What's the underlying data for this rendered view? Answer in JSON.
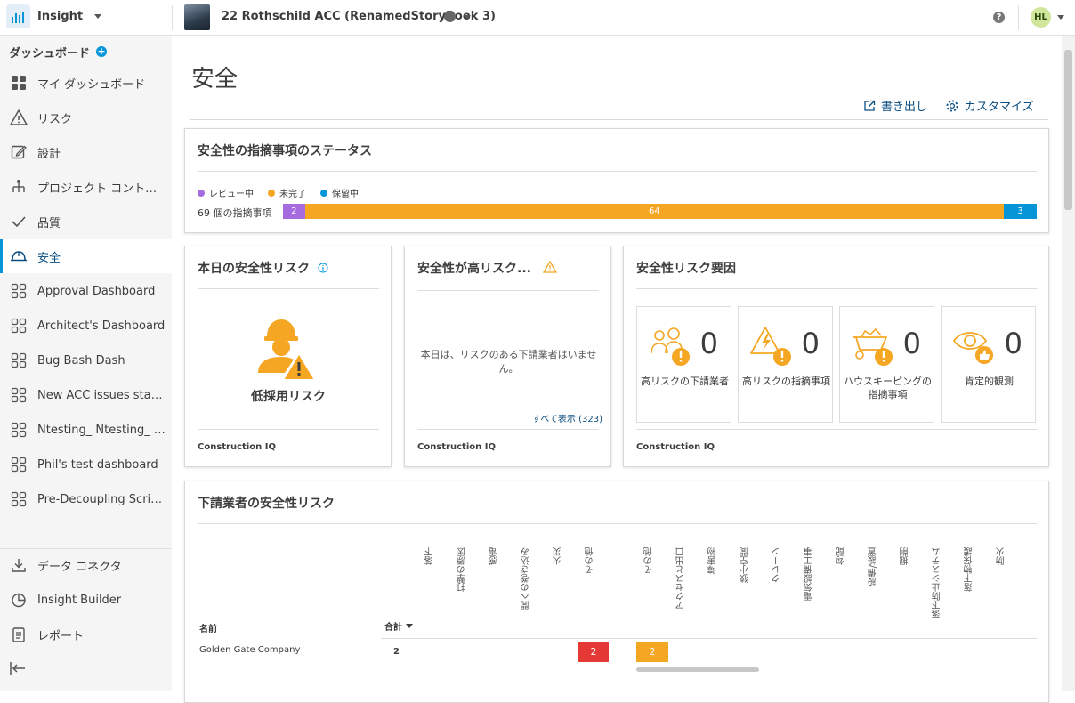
{
  "header": {
    "app_name": "Insight",
    "project_name": "22 Rothschild ACC (RenamedStoryBook 3)",
    "help": "?",
    "avatar_initials": "HL"
  },
  "sidebar": {
    "heading": "ダッシュボード",
    "items": [
      {
        "label": "マイ ダッシュボード",
        "icon": "grid-icon"
      },
      {
        "label": "リスク",
        "icon": "warning-icon"
      },
      {
        "label": "設計",
        "icon": "pencil-icon"
      },
      {
        "label": "プロジェクト コントロ...",
        "icon": "hierarchy-icon"
      },
      {
        "label": "品質",
        "icon": "check-icon"
      },
      {
        "label": "安全",
        "icon": "hard-hat-icon"
      },
      {
        "label": "Approval Dashboard",
        "icon": "dashboard-icon"
      },
      {
        "label": "Architect's Dashboard",
        "icon": "dashboard-icon"
      },
      {
        "label": "Bug Bash Dash",
        "icon": "dashboard-icon"
      },
      {
        "label": "New ACC issues status...",
        "icon": "dashboard-icon"
      },
      {
        "label": "Ntesting_ Ntesting_ N...",
        "icon": "dashboard-icon"
      },
      {
        "label": "Phil's test dashboard",
        "icon": "dashboard-icon"
      },
      {
        "label": "Pre-Decoupling Script ...",
        "icon": "dashboard-icon"
      }
    ],
    "bottom_items": [
      {
        "label": "データ コネクタ",
        "icon": "download-icon"
      },
      {
        "label": "Insight Builder",
        "icon": "pie-chart-icon"
      },
      {
        "label": "レポート",
        "icon": "report-icon"
      }
    ],
    "active_index": 5
  },
  "page": {
    "title": "安全",
    "export_label": "書き出し",
    "customize_label": "カスタマイズ"
  },
  "status_card": {
    "title": "安全性の指摘事項のステータス",
    "legend": [
      {
        "label": "レビュー中",
        "color": "#a56bdf"
      },
      {
        "label": "未完了",
        "color": "#f5a623"
      },
      {
        "label": "保留中",
        "color": "#0696d7"
      }
    ],
    "count_label": "69 個の指摘事項",
    "segments": [
      {
        "value": 2,
        "color": "#a56bdf"
      },
      {
        "value": 64,
        "color": "#f5a623"
      },
      {
        "value": 3,
        "color": "#0696d7"
      }
    ]
  },
  "today_card": {
    "title": "本日の安全性リスク",
    "risk_label": "低採用リスク",
    "footer": "Construction IQ"
  },
  "high_risk_card": {
    "title": "安全性が高リスク...",
    "empty_text": "本日は、リスクのある下請業者はいません。",
    "view_all": "すべて表示 (323)",
    "footer": "Construction IQ"
  },
  "factors_card": {
    "title": "安全性リスク要因",
    "factors": [
      {
        "label": "高リスクの下請業者",
        "value": "0"
      },
      {
        "label": "高リスクの指摘事項",
        "value": "0"
      },
      {
        "label": "ハウスキーピングの指摘事項",
        "value": "0"
      },
      {
        "label": "肯定的観測",
        "value": "0"
      }
    ],
    "footer": "Construction IQ"
  },
  "sub_card": {
    "title": "下請業者の安全性リスク",
    "name_header": "名前",
    "total_header": "合計",
    "columns": [
      "落下",
      "打撃の原因",
      "感電",
      "間への巻き込み",
      "火災",
      "その他",
      "その他",
      "アクセスと出口",
      "障害物",
      "狭小空間",
      "クレーン",
      "電気設備工事",
      "勾配",
      "設備/設置",
      "掘削",
      "落下防止システム",
      "落下物保護",
      "防火"
    ],
    "rows": [
      {
        "name": "Golden Gate Company",
        "total": "2",
        "red_value": "2",
        "orange_value": "2"
      }
    ]
  }
}
